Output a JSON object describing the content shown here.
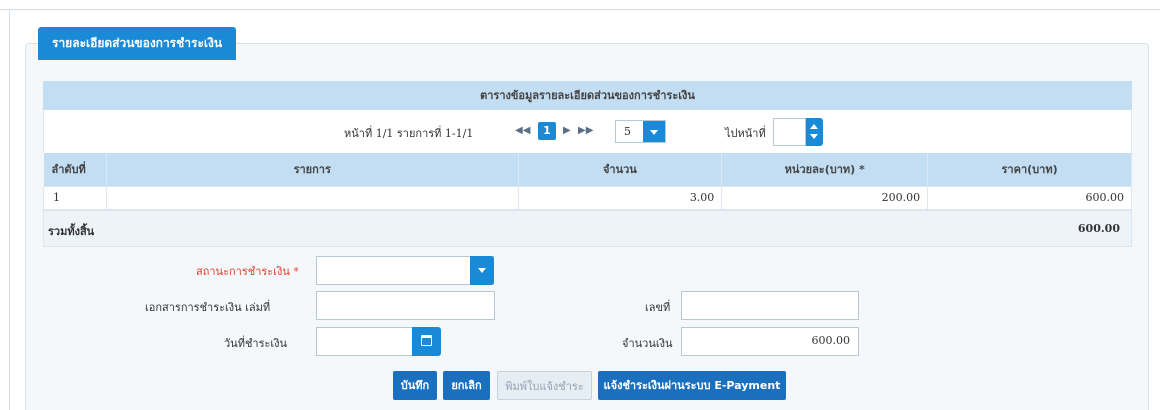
{
  "section_title": "รายละเอียดส่วนของการชำระเงิน",
  "grid_title": "ตารางข้อมูลรายละเอียดส่วนของการชำระเงิน",
  "pager": {
    "info": "หน้าที่ 1/1 รายการที่ 1-1/1",
    "current_page": "1",
    "page_size": "5",
    "goto_label": "ไปหน้าที่"
  },
  "columns": [
    "ลำดับที่",
    "รายการ",
    "จำนวน",
    "หน่วยละ(บาท) *",
    "ราคา(บาท)"
  ],
  "rows": [
    {
      "no": "1",
      "item": "",
      "qty": "3.00",
      "unit": "200.00",
      "price": "600.00"
    }
  ],
  "total": {
    "label": "รวมทั้งสิ้น",
    "value": "600.00"
  },
  "form": {
    "status_label": "สถานะการชำระเงิน",
    "required_mark": "*",
    "doc_book_label": "เอกสารการชำระเงิน เล่มที่",
    "doc_no_label": "เลขที่",
    "pay_date_label": "วันที่ชำระเงิน",
    "amount_label": "จำนวนเงิน",
    "amount_value": "600.00"
  },
  "buttons": {
    "save": "บันทึก",
    "cancel": "ยกเลิก",
    "print_notice": "พิมพ์ใบแจ้งชำระ",
    "epayment": "แจ้งชำระเงินผ่านระบบ E-Payment"
  },
  "colors": {
    "accent": "#1a8ad6",
    "header_bg": "#c3ddf3",
    "required": "#e53c2d"
  }
}
